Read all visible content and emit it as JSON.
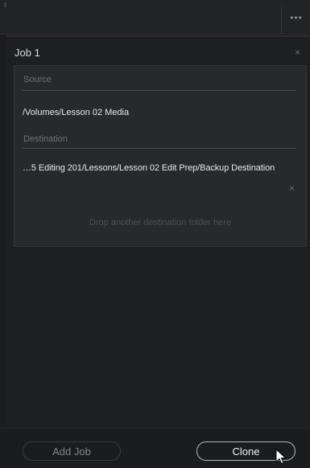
{
  "topbar": {
    "menu_icon": "ellipsis-icon",
    "menu_glyph": "•••"
  },
  "job": {
    "title": "Job 1",
    "close_glyph": "×",
    "source": {
      "label": "Source",
      "path": "/Volumes/Lesson 02 Media"
    },
    "destination": {
      "label": "Destination",
      "path": "…5 Editing 201/Lessons/Lesson 02 Edit Prep/Backup Destination",
      "remove_glyph": "×"
    },
    "drop_hint": "Drop another destination folder here"
  },
  "bottombar": {
    "add_job_label": "Add Job",
    "clone_label": "Clone"
  },
  "colors": {
    "background": "#1b1c20",
    "box": "#28292d",
    "text": "#e6e7ea",
    "muted": "#6f7075"
  }
}
